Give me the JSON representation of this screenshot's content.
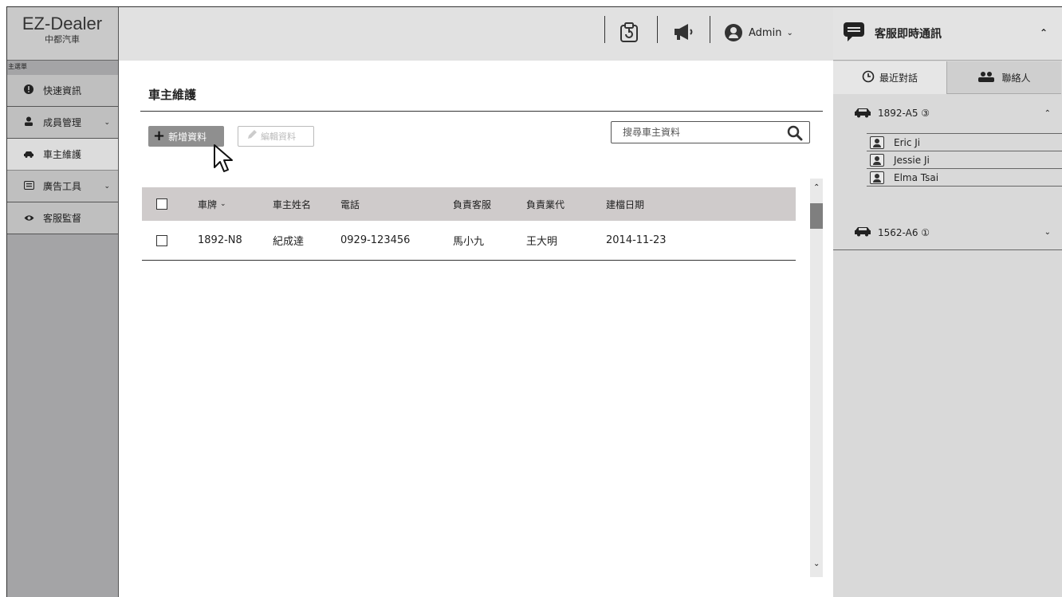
{
  "sidebar": {
    "logo_title": "EZ-Dealer",
    "logo_subtitle": "中都汽車",
    "menu_label": "主選單",
    "items": [
      {
        "label": "快速資訊",
        "icon": "info-icon"
      },
      {
        "label": "成員管理",
        "icon": "person-icon",
        "expandable": true
      },
      {
        "label": "車主維護",
        "icon": "car-icon",
        "active": true
      },
      {
        "label": "廣告工具",
        "icon": "ad-icon",
        "expandable": true
      },
      {
        "label": "客服監督",
        "icon": "eye-icon"
      }
    ]
  },
  "topbar": {
    "icons": [
      "clipboard-icon",
      "megaphone-icon"
    ],
    "user_label": "Admin"
  },
  "main": {
    "page_title": "車主維護",
    "add_button": "新增資料",
    "edit_button": "編輯資料",
    "search_placeholder": "搜尋車主資料",
    "table": {
      "columns": [
        "車牌",
        "車主姓名",
        "電話",
        "負責客服",
        "負責業代",
        "建檔日期"
      ],
      "rows": [
        [
          "1892-N8",
          "紀成達",
          "0929-123456",
          "馬小九",
          "王大明",
          "2014-11-23"
        ]
      ]
    }
  },
  "chat": {
    "title": "客服即時通訊",
    "tab_recent": "最近對話",
    "tab_contacts": "聯絡人",
    "groups": [
      {
        "plate": "1892-A5 ③",
        "expanded": true,
        "contacts": [
          "Eric Ji",
          "Jessie Ji",
          "Elma Tsai"
        ]
      },
      {
        "plate": "1562-A6 ①",
        "expanded": false,
        "contacts": []
      }
    ]
  },
  "colors": {
    "sidebar_bg": "#a4a4a6",
    "topbar_bg": "#e1e1e1",
    "table_header_bg": "#cfcbcb",
    "chat_bg": "#d9d9d9"
  }
}
